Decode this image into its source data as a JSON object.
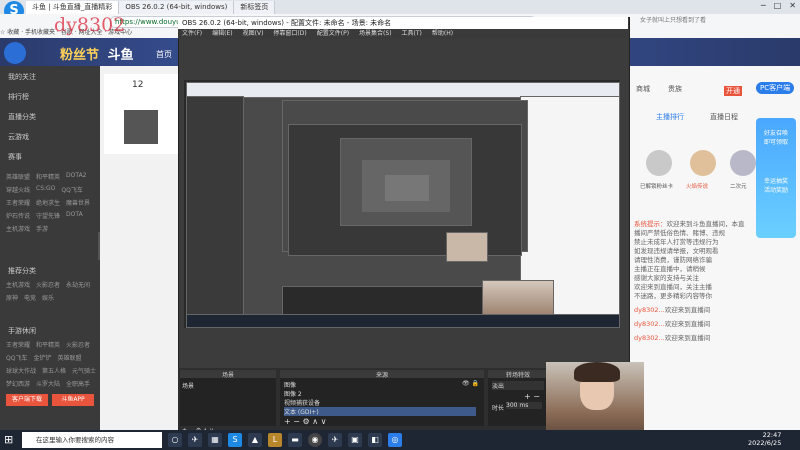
{
  "browser": {
    "tabs": [
      "斗鱼 | 斗鱼直播_直播精彩",
      "OBS 26.0.2 (64-bit, windows)",
      "新标签页"
    ],
    "url": "https://www.douyu.com/...",
    "search_hint": "女子就叫上只想看到了看",
    "bookmarks": "☆ 收藏 · 手机收藏夹 · 谷歌 · 网址大全 · 游戏中心",
    "window_controls": [
      "─",
      "□",
      "✕"
    ]
  },
  "watermark": "dy8302",
  "douyu": {
    "logo": "斗鱼",
    "logo_sub": "粉丝节",
    "nav_home": "首页",
    "left_nav": [
      "我的关注",
      "排行榜",
      "直播分类",
      "云游戏",
      "赛事"
    ],
    "grid_a": [
      "英雄联盟",
      "和平精英",
      "DOTA2",
      "穿越火线",
      "CS:GO",
      "QQ飞车",
      "王者荣耀",
      "绝地求生",
      "魔兽世界",
      "炉石传说",
      "守望先锋",
      "DOTA",
      "主机游戏",
      "手游"
    ],
    "section_b": "推荐分类",
    "grid_b": [
      "主机游戏",
      "火影忍者",
      "永劫无间",
      "原神",
      "电竞",
      "娱乐"
    ],
    "section_c": "手游休闲",
    "grid_c": [
      "王者荣耀",
      "和平精英",
      "火影忍者",
      "QQ飞车",
      "金铲铲",
      "英雄联盟",
      "球球大作战",
      "第五人格",
      "元气骑士",
      "梦幻西游",
      "斗罗大陆",
      "全职高手"
    ],
    "btn_download": "客户端下载",
    "btn_app": "斗鱼APP",
    "fans": "12",
    "right": {
      "shop": "商城",
      "vip": "贵族",
      "open": "开通",
      "pc_badge": "PC客户端",
      "tab_rank": "主播排行",
      "tab_gift": "直播日程",
      "fans_card_a": "已解锁粉丝卡",
      "fans_card_b": "火焰传说",
      "fans_card_c": "二次元"
    },
    "chat": [
      {
        "u": "系统提示：",
        "t": "欢迎来到斗鱼直播间，本直"
      },
      {
        "u": "",
        "t": "播间严禁低俗色情、赌博、违规"
      },
      {
        "u": "",
        "t": "禁止未成年人打赏等违规行为"
      },
      {
        "u": "",
        "t": "如发现违规请举报，文明观看"
      },
      {
        "u": "",
        "t": "请理性消费，谨防网络诈骗"
      },
      {
        "u": "",
        "t": "主播正在直播中，请稍候"
      },
      {
        "u": "",
        "t": "感谢大家的支持与关注"
      },
      {
        "u": "",
        "t": "欢迎来到直播间，关注主播"
      },
      {
        "u": "",
        "t": "不迷路，更多精彩内容等你"
      },
      {
        "u": "dy8302...",
        "t": "欢迎来到直播间"
      },
      {
        "u": "dy8302...",
        "t": "欢迎来到直播间"
      },
      {
        "u": "dy8302...",
        "t": "欢迎来到直播间"
      }
    ],
    "promo": [
      "好友召唤",
      "即可领取",
      "幸运抽奖",
      "活动奖励"
    ]
  },
  "obs": {
    "title": "OBS 26.0.2 (64-bit, windows) - 配置文件: 未命名 - 场景: 未命名",
    "menu": [
      "文件(F)",
      "编辑(E)",
      "视图(V)",
      "停靠窗口(D)",
      "配置文件(P)",
      "场景集合(S)",
      "工具(T)",
      "帮助(H)"
    ],
    "dock_scenes": "场景",
    "dock_sources": "来源",
    "dock_transitions": "转场特效",
    "scene_item": "场景",
    "sources": [
      "图像",
      "图像 2",
      "视频捕获设备",
      "文本 (GDI+)"
    ],
    "transition_name": "淡出",
    "duration_label": "时长",
    "duration_value": "300 ms",
    "dock_controls": "+ − ⚙ ∧ ∨"
  },
  "taskbar": {
    "search_placeholder": "在这里输入你要搜索的内容",
    "time": "22:47",
    "date": "2022/6/25"
  }
}
